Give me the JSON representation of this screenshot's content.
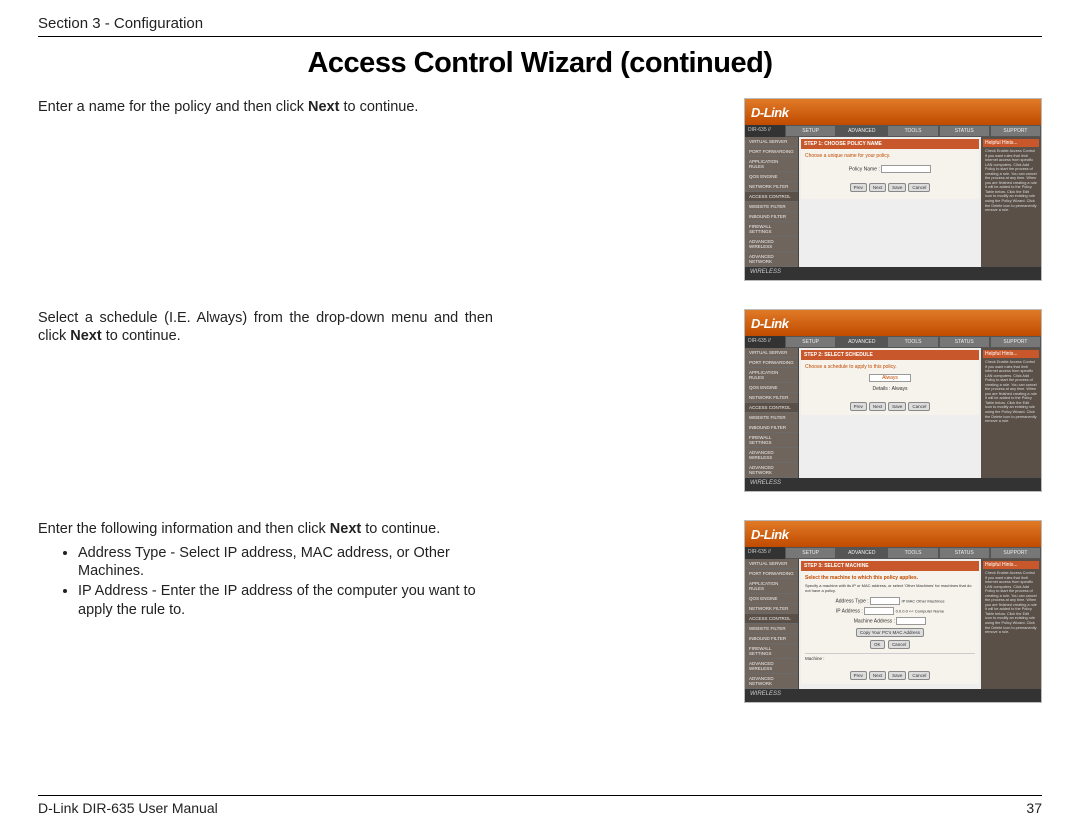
{
  "header": {
    "section": "Section 3 - Configuration"
  },
  "title": "Access Control Wizard (continued)",
  "rows": [
    {
      "text_html": "Enter a name for the policy and then click <b>Next</b> to continue.",
      "shot": {
        "step_title": "STEP 1: CHOOSE POLICY NAME",
        "prompt": "Choose a unique name for your policy.",
        "field_label": "Policy Name :",
        "field_type": "text"
      }
    },
    {
      "text_html": "Select a schedule (I.E. Always) from the drop-down menu and then click <b>Next</b> to continue.",
      "shot": {
        "step_title": "STEP 2: SELECT SCHEDULE",
        "prompt": "Choose a schedule to apply to this policy.",
        "field_label": "",
        "field_value": "Always",
        "details_label": "Details : Always"
      }
    },
    {
      "text_html": "Enter the following information and then click <b>Next</b> to continue.",
      "bullets": [
        "Address Type - Select IP address, MAC address, or Other Machines.",
        "IP Address - Enter the IP address of the computer you want to apply the rule to."
      ],
      "shot": {
        "step_title": "STEP 3: SELECT MACHINE",
        "prompt": "Select the machine to which this policy applies.",
        "sub": "Specify a machine with its IP or MAC address, or select 'Other Machines' for machines that do not have a policy.",
        "fields": [
          {
            "label": "Address Type :",
            "value": "IP  MAC  Other Machines"
          },
          {
            "label": "IP Address :",
            "value": "0.0.0.0    << Computer Name"
          },
          {
            "label": "Machine Address :",
            "value": ""
          }
        ],
        "extra_btn": "Copy Your PC's MAC Address"
      }
    }
  ],
  "router": {
    "model": "DIR-635",
    "tabs": [
      "SETUP",
      "ADVANCED",
      "TOOLS",
      "STATUS",
      "SUPPORT"
    ],
    "active_tab": "ADVANCED",
    "side": [
      "VIRTUAL SERVER",
      "PORT FORWARDING",
      "APPLICATION RULES",
      "QOS ENGINE",
      "NETWORK FILTER",
      "ACCESS CONTROL",
      "WEBSITE FILTER",
      "INBOUND FILTER",
      "FIREWALL SETTINGS",
      "ADVANCED WIRELESS",
      "ADVANCED NETWORK"
    ],
    "buttons": [
      "Prev",
      "Next",
      "Save",
      "Cancel"
    ],
    "hints_title": "Helpful Hints...",
    "hints_body": "Check Enable Access Control if you want rules that limit Internet access from specific LAN computers. Click Add Policy to start the process of creating a rule. You can cancel the process at any time. When you are finished creating a rule it will be added to the Policy Table below. Click the Edit icon to modify an existing rule using the Policy Wizard. Click the Delete icon to permanently remove a rule.",
    "footer_brand": "WIRELESS"
  },
  "footer": {
    "left": "D-Link DIR-635 User Manual",
    "right": "37"
  }
}
